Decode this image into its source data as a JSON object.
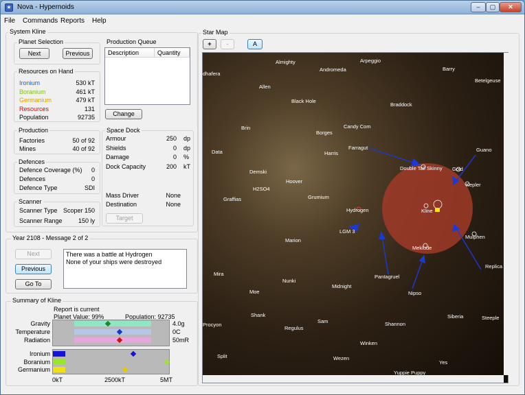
{
  "window": {
    "title": "Nova - Hypernoids",
    "min": "–",
    "max": "▢",
    "close": "✕",
    "icon_glyph": "★"
  },
  "menu": [
    "File",
    "Commands",
    "Reports",
    "Help"
  ],
  "system": {
    "group_label": "System Kline",
    "planet_selection": {
      "label": "Planet Selection",
      "next": "Next",
      "previous": "Previous"
    },
    "resources": {
      "label": "Resources on Hand",
      "rows": [
        {
          "name": "Ironium",
          "value": "530 kT",
          "color": "#1a64d6"
        },
        {
          "name": "Boranium",
          "value": "461 kT",
          "color": "#7fc300"
        },
        {
          "name": "Germanium",
          "value": "479 kT",
          "color": "#d8a400"
        },
        {
          "name": "Resources",
          "value": "131",
          "color": "#e00000"
        },
        {
          "name": "Population",
          "value": "92735",
          "color": "#000000"
        }
      ]
    },
    "production": {
      "label": "Production",
      "factories_label": "Factories",
      "factories_value": "50 of 92",
      "mines_label": "Mines",
      "mines_value": "40 of 92"
    },
    "defences": {
      "label": "Defences",
      "coverage_label": "Defence Coverage (%)",
      "coverage_value": "0",
      "defences_label": "Defences",
      "defences_value": "0",
      "type_label": "Defence Type",
      "type_value": "SDI"
    },
    "scanner": {
      "label": "Scanner",
      "type_label": "Scanner Type",
      "type_value": "Scoper 150",
      "range_label": "Scanner Range",
      "range_value": "150 ly"
    },
    "production_queue": {
      "label": "Production Queue",
      "col_description": "Description",
      "col_quantity": "Quantity",
      "change": "Change"
    },
    "space_dock": {
      "label": "Space Dock",
      "rows": [
        {
          "name": "Armour",
          "value": "250",
          "unit": "dp"
        },
        {
          "name": "Shields",
          "value": "0",
          "unit": "dp"
        },
        {
          "name": "Damage",
          "value": "0",
          "unit": "%"
        },
        {
          "name": "Dock Capacity",
          "value": "200",
          "unit": "kT"
        }
      ]
    },
    "mass_driver": {
      "label": "Mass Driver",
      "value": "None",
      "dest_label": "Destination",
      "dest_value": "None",
      "target": "Target"
    }
  },
  "messages": {
    "label": "Year 2108 - Message 2 of 2",
    "next": "Next",
    "previous": "Previous",
    "goto": "Go To",
    "line1": "There was a battle at Hydrogen",
    "line2": "None of your ships were destroyed"
  },
  "summary": {
    "label": "Summary of Kline",
    "report": "Report is current",
    "planet_value": "Planet Value: 99%",
    "population": "Population: 92735",
    "env": [
      {
        "name": "Gravity",
        "value": "4.0g",
        "color": "#8fe6c4",
        "marker": "#1a8a2a",
        "level": 0.44
      },
      {
        "name": "Temperature",
        "value": "0C",
        "color": "#b4c8e6",
        "marker": "#1638c8",
        "level": 0.59
      },
      {
        "name": "Radiation",
        "value": "50mR",
        "color": "#e6a8dc",
        "marker": "#d01010",
        "level": 0.59
      }
    ],
    "minerals": [
      {
        "name": "Ironium",
        "color": "#1414d8",
        "marker": "#1414d8",
        "level": 0.69
      },
      {
        "name": "Boranium",
        "color": "#9ae62a",
        "marker": "#9ae62a",
        "level": 0.98
      },
      {
        "name": "Germanium",
        "color": "#f0e014",
        "marker": "#e8c800",
        "level": 0.62
      }
    ],
    "axis": [
      "0kT",
      "2500kT",
      "5MT"
    ]
  },
  "starmap": {
    "label": "Star Map",
    "zoom_in": "+",
    "zoom_out": "-",
    "toggle": "A",
    "stars": [
      "Almighty",
      "Andromeda",
      "Arpeggio",
      "Barry",
      "dhafera",
      "Betelgeuse",
      "Allen",
      "Black Hole",
      "Braddock",
      "Brin",
      "Candy Com",
      "Borges",
      "Farragut",
      "Guano",
      "Data",
      "Harris",
      "Double Tail Skinny",
      "Gold",
      "Demski",
      "Hoover",
      "Kepler",
      "H2SO4",
      "Graffias",
      "Grumium",
      "Hydrogen",
      "Kline",
      "LGM 3",
      "Marion",
      "Mulphen",
      "Meklude",
      "Replica",
      "Mira",
      "Pantagruel",
      "Nunki",
      "Midnight",
      "Moe",
      "Nipso",
      "Shank",
      "Siberia",
      "Steeple",
      "Procyon",
      "Sam",
      "Regulus",
      "Shannon",
      "Winken",
      "Split",
      "Wezen",
      "Yes",
      "Yuppie Puppy"
    ]
  }
}
